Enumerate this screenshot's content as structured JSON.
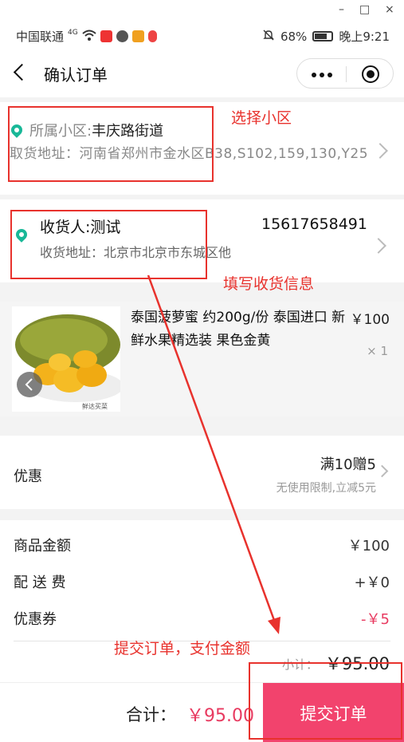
{
  "window": {
    "minimize": "–",
    "maximize": "□",
    "close": "×"
  },
  "statusbar": {
    "carrier": "中国联通",
    "network": "4G",
    "battery_pct": "68%",
    "time": "晚上9:21"
  },
  "navbar": {
    "title": "确认订单"
  },
  "pickup": {
    "label": "所属小区:",
    "community": "丰庆路街道",
    "address": "取货地址：河南省郑州市金水区B38,S102,159,130,Y25"
  },
  "receiver": {
    "name": "收货人:测试",
    "phone": "15617658491",
    "address": "收货地址：北京市北京市东城区他"
  },
  "product": {
    "name": "泰国菠萝蜜 约200g/份 泰国进口 新鲜水果精选装 果色金黄",
    "price": "￥100",
    "qty": "× 1",
    "image_caption": "鲜达买菜"
  },
  "discount": {
    "label": "优惠",
    "title": "满10赠5",
    "subtitle": "无使用限制,立减5元"
  },
  "summary": {
    "goods_label": "商品金额",
    "goods_value": "￥100",
    "shipping_label": "配 送 费",
    "shipping_value": "+￥0",
    "coupon_label": "优惠券",
    "coupon_value": "-￥5",
    "subtotal_label": "小计：",
    "subtotal_value": "￥95.00"
  },
  "bottom": {
    "total_label": "合计：",
    "total_value": "￥95.00",
    "submit_label": "提交订单"
  },
  "annotations": {
    "choose_community": "选择小区",
    "fill_receiver": "填写收货信息",
    "submit_pay": "提交订单，支付金额"
  },
  "colors": {
    "accent": "#f2436d",
    "price_red": "#e83a60",
    "pin_green": "#19b898",
    "annotation_red": "#e8322d"
  }
}
